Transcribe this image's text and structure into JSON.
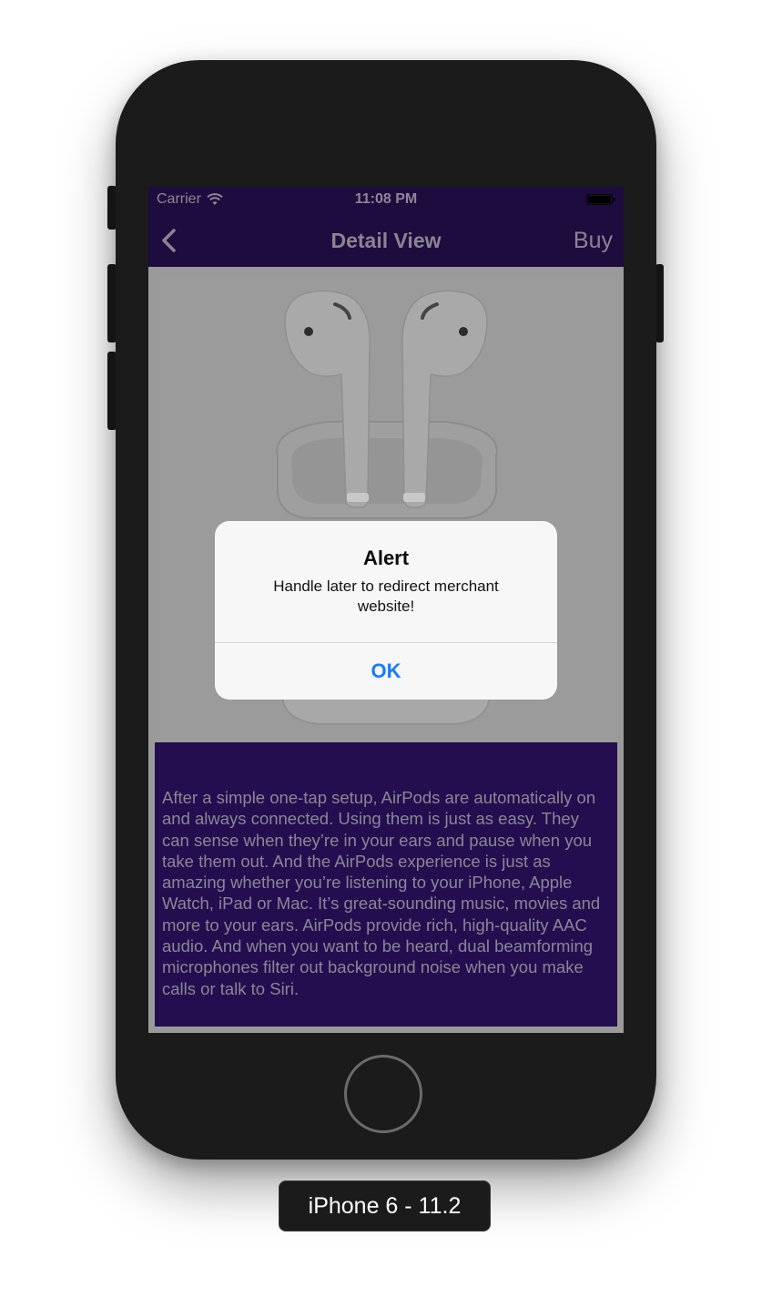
{
  "status_bar": {
    "carrier": "Carrier",
    "time": "11:08 PM"
  },
  "nav": {
    "title": "Detail View",
    "buy_label": "Buy"
  },
  "description": "After a simple one-tap setup, AirPods are automatically on and always connected. Using them is just as easy. They can sense when they’re in your ears and pause when you take them out. And the AirPods experience is just as amazing whether you’re listening to your iPhone, Apple Watch, iPad or Mac. It’s great-sounding music, movies and more to your ears. AirPods provide rich, high-quality AAC audio. And when you want to be heard, dual beamforming microphones filter out background noise when you make calls or talk to Siri.",
  "alert": {
    "title": "Alert",
    "message": "Handle later to redirect merchant website!",
    "ok_label": "OK"
  },
  "device_label": "iPhone 6 - 11.2",
  "colors": {
    "nav_background": "#1f0c3e",
    "description_background": "#250e4f",
    "alert_button": "#1a7cf5"
  },
  "icons": {
    "back": "chevron-left-icon",
    "wifi": "wifi-icon",
    "battery": "battery-icon",
    "product": "airpods-image"
  }
}
